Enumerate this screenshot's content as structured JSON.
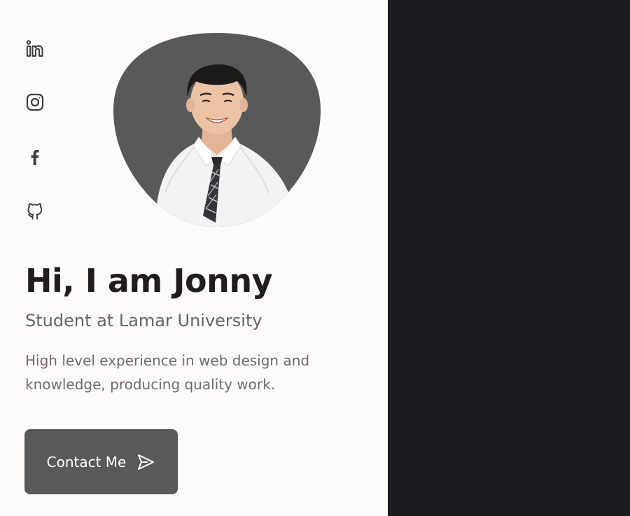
{
  "social_links": [
    {
      "name": "linkedin",
      "icon": "linkedin-icon"
    },
    {
      "name": "instagram",
      "icon": "instagram-icon"
    },
    {
      "name": "facebook",
      "icon": "facebook-icon"
    },
    {
      "name": "github",
      "icon": "github-icon"
    }
  ],
  "hero": {
    "greeting": "Hi, I am Jonny",
    "subtitle": "Student at Lamar University",
    "description": "High level experience in web design and knowledge, producing quality work.",
    "contact_button": {
      "label": "Contact Me",
      "icon": "send-icon"
    }
  },
  "colors": {
    "left_background": "#fcfbfa",
    "right_background": "#1b1b20",
    "blob_background": "#595959",
    "heading": "#211c1e",
    "subtitle": "#6e5e63",
    "description": "#75676b",
    "button_background": "#595959",
    "icon": "#3d3d3d"
  }
}
